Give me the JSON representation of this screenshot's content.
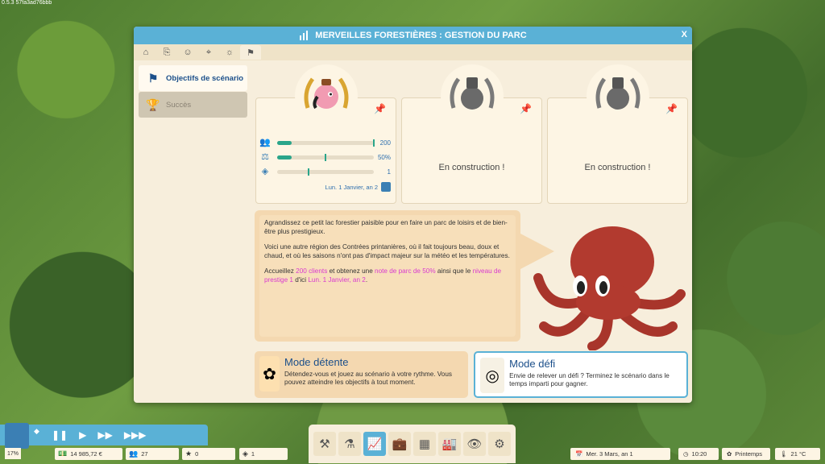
{
  "version": "0.5.3 57fa3ad76bbb",
  "window": {
    "title": "MERVEILLES FORESTIÈRES : GESTION DU PARC",
    "close_label": "X",
    "tabs": [
      "bench-icon",
      "ticket-icon",
      "staff-icon",
      "map-icon",
      "attraction-icon",
      "flag-icon"
    ]
  },
  "sidebar": {
    "items": [
      {
        "label": "Objectifs de scénario",
        "icon": "checkered-flag-icon"
      },
      {
        "label": "Succès",
        "icon": "trophy-icon"
      }
    ]
  },
  "objectives": {
    "card1": {
      "stats": [
        {
          "icon": "visitors-icon",
          "value": "200",
          "progress": 0.15,
          "target": 1.0
        },
        {
          "icon": "rating-icon",
          "value": "50%",
          "progress": 0.15,
          "target": 0.5
        },
        {
          "icon": "prestige-icon",
          "value": "1",
          "progress": 0.0,
          "target": 0.33
        }
      ],
      "date": "Lun. 1 Janvier, an 2"
    },
    "card2": {
      "status": "En construction !"
    },
    "card3": {
      "status": "En construction !"
    }
  },
  "description": {
    "p1": "Agrandissez ce petit lac forestier paisible pour en faire un parc de loisirs et de bien-être plus prestigieux.",
    "p2": "Voici une autre région des Contrées printanières, où il fait toujours beau, doux et chaud, et où les saisons n'ont pas d'impact majeur sur la météo et les températures.",
    "p3": {
      "t1": "Accueillez ",
      "h1": "200 clients",
      "t2": " et obtenez une ",
      "h2": "note de parc de 50%",
      "t3": " ainsi que le ",
      "h3": "niveau de prestige 1",
      "t4": " d'ici ",
      "h4": "Lun. 1 Janvier, an 2",
      "t5": "."
    }
  },
  "modes": {
    "relax": {
      "title": "Mode détente",
      "text": "Détendez-vous et jouez au scénario à votre rythme. Vous pouvez atteindre les objectifs à tout moment."
    },
    "challenge": {
      "title": "Mode défi",
      "text": "Envie de relever un défi ? Terminez le scénario dans le temps imparti pour gagner."
    }
  },
  "hud": {
    "percent": "17%",
    "money": "14 985,72 €",
    "guests": "27",
    "stars": "0",
    "prestige": "1",
    "date": "Mer. 3 Mars, an 1",
    "time": "10:20",
    "season": "Printemps",
    "temperature": "21 °C"
  },
  "colors": {
    "accent": "#5ab1d6",
    "highlight": "#d93ad0",
    "bar": "#2aa58a",
    "panel": "#f7eedc"
  }
}
